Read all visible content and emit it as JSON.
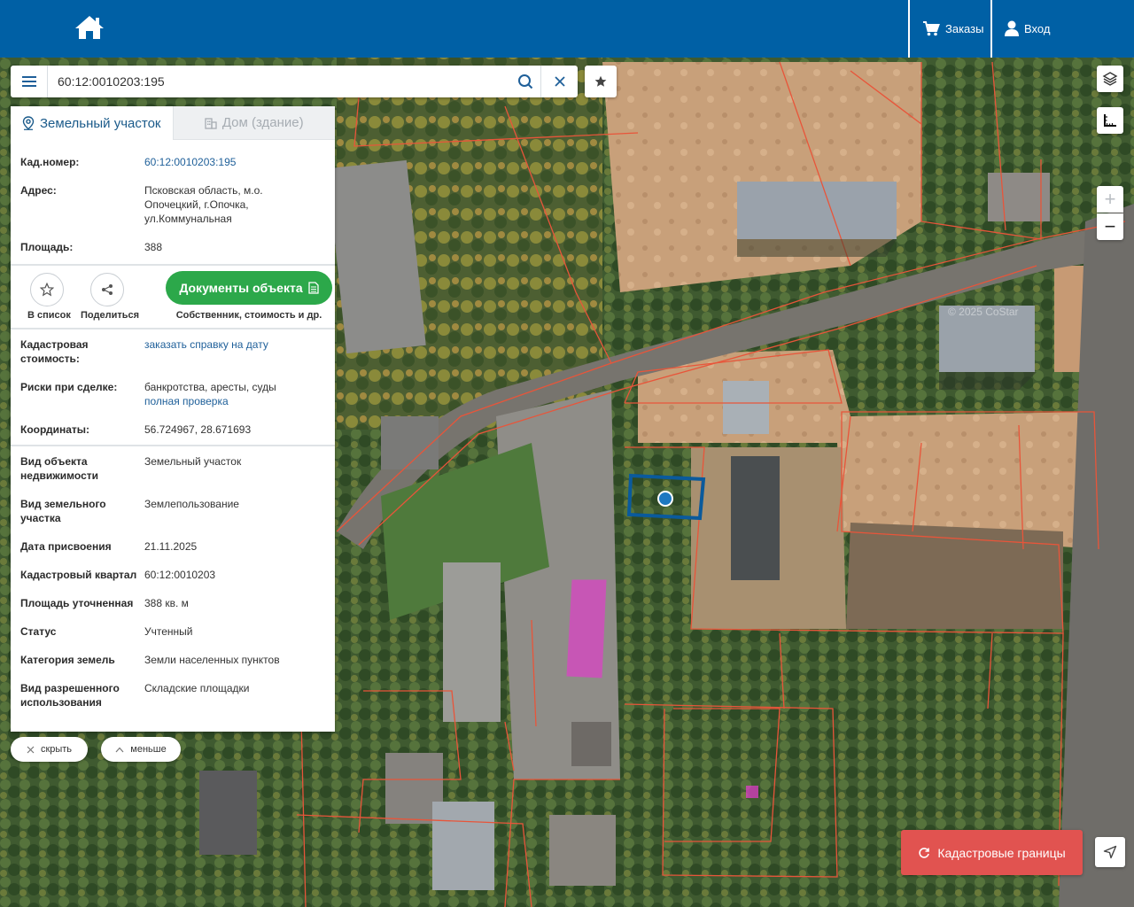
{
  "header": {
    "orders_label": "Заказы",
    "login_label": "Вход"
  },
  "search": {
    "value": "60:12:0010203:195"
  },
  "tabs": [
    {
      "label": "Земельный участок",
      "active": true
    },
    {
      "label": "Дом (здание)",
      "active": false
    }
  ],
  "summary": [
    {
      "key": "Кад.номер:",
      "value": "60:12:0010203:195"
    },
    {
      "key": "Адрес:",
      "value": "Псковская область, м.о. Опочецкий, г.Опочка, ул.Коммунальная"
    },
    {
      "key": "Площадь:",
      "value": "388"
    }
  ],
  "actions": {
    "to_list": "В список",
    "share": "Поделиться",
    "documents": "Документы объекта",
    "documents_sub": "Собственник, стоимость и др."
  },
  "extra": {
    "cost_key": "Кадастровая стоимость:",
    "cost_link": "заказать справку на дату",
    "risks_key": "Риски при сделке:",
    "risks_value": "банкротства, аресты, суды",
    "risks_link": "полная проверка",
    "coords_key": "Координаты:",
    "coords_value": "56.724967, 28.671693"
  },
  "details": [
    {
      "key": "Вид объекта недвижимости",
      "value": "Земельный участок"
    },
    {
      "key": "Вид земельного участка",
      "value": "Землепользование"
    },
    {
      "key": "Дата присвоения",
      "value": "21.11.2025"
    },
    {
      "key": "Кадастровый квартал",
      "value": "60:12:0010203"
    },
    {
      "key": "Площадь уточненная",
      "value": "388 кв. м"
    },
    {
      "key": "Статус",
      "value": "Учтенный"
    },
    {
      "key": "Категория земель",
      "value": "Земли населенных пунктов"
    },
    {
      "key": "Вид разрешенного использования",
      "value": "Складские площадки"
    }
  ],
  "pills": {
    "hide": "скрыть",
    "less": "меньше"
  },
  "cadastral_button": "Кадастровые границы",
  "copyright": "© 2025 CoStar",
  "colors": {
    "topbar": "#0060a5",
    "link": "#1e5f99",
    "docs_green": "#2ca84a",
    "cadastral_red": "#e15350",
    "boundary": "#e8553a",
    "selected_parcel": "#0a5a9c",
    "building_highlight": "#e040c8"
  }
}
